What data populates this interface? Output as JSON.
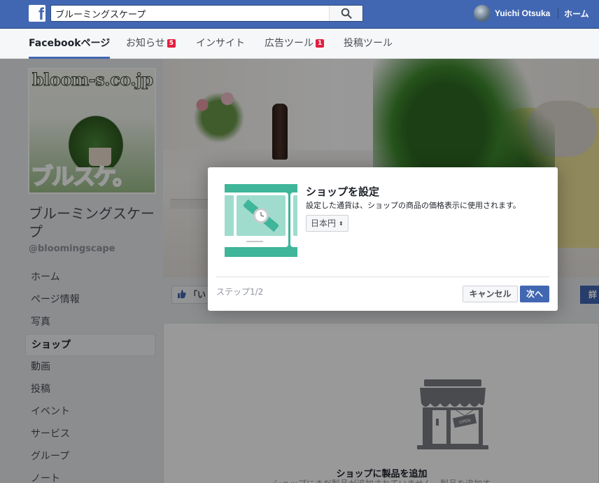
{
  "topbar": {
    "logo_letter": "f",
    "search_value": "ブルーミングスケープ",
    "user_name": "Yuichi Otsuka",
    "home_label": "ホーム"
  },
  "page_tabs": [
    {
      "label": "Facebookページ",
      "badge": ""
    },
    {
      "label": "お知らせ",
      "badge": "5"
    },
    {
      "label": "インサイト",
      "badge": ""
    },
    {
      "label": "広告ツール",
      "badge": "1"
    },
    {
      "label": "投稿ツール",
      "badge": ""
    }
  ],
  "sidebar": {
    "profile_domain": "bloom-s.co.jp",
    "profile_word": "ブルスケ。",
    "page_name": "ブルーミングスケープ",
    "page_handle": "@bloomingscape",
    "items": [
      {
        "label": "ホーム"
      },
      {
        "label": "ページ情報"
      },
      {
        "label": "写真"
      },
      {
        "label": "ショップ"
      },
      {
        "label": "動画"
      },
      {
        "label": "投稿"
      },
      {
        "label": "イベント"
      },
      {
        "label": "サービス"
      },
      {
        "label": "グループ"
      },
      {
        "label": "ノート"
      }
    ]
  },
  "main": {
    "like_button": "「い",
    "detail_button": "詳",
    "shop_sign": "OPEN",
    "shop_title": "ショップに製品を追加",
    "shop_desc": "ショップにまだ製品が追加されていません。製品を追加す"
  },
  "dialog": {
    "title": "ショップを設定",
    "description": "設定した通貨は、ショップの商品の価格表示に使用されます。",
    "currency": "日本円",
    "step": "ステップ1/2",
    "cancel": "キャンセル",
    "next": "次へ"
  },
  "colors": {
    "brand": "#4267b2",
    "teal": "#3fb59a",
    "badge": "#e41e3f"
  }
}
